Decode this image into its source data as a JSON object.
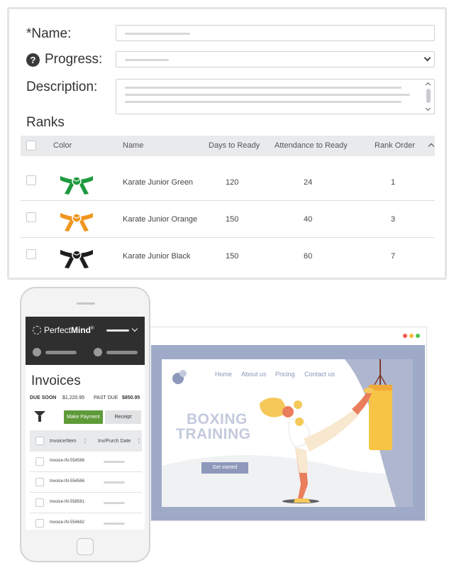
{
  "form": {
    "name_label": "*Name:",
    "progress_label": "Progress:",
    "help_glyph": "?",
    "description_label": "Description:"
  },
  "ranks": {
    "title": "Ranks",
    "columns": [
      "Color",
      "Name",
      "Days to Ready",
      "Attendance to Ready",
      "Rank Order"
    ],
    "rows": [
      {
        "belt_color": "#1f9a3e",
        "name": "Karate Junior Green",
        "days": "120",
        "attendance": "24",
        "order": "1"
      },
      {
        "belt_color": "#f0961e",
        "name": "Karate Junior Orange",
        "days": "150",
        "attendance": "40",
        "order": "3"
      },
      {
        "belt_color": "#1e1e1e",
        "name": "Karate Junior Black",
        "days": "150",
        "attendance": "60",
        "order": "7"
      }
    ]
  },
  "phone": {
    "brand_light": "Perfect",
    "brand_bold": "Mind",
    "brand_mark": "®",
    "title": "Invoices",
    "due_soon_label": "DUE SOON",
    "due_soon_value": "$1,220.95",
    "past_due_label": "PAST DUE",
    "past_due_value": "$850.95",
    "make_payment": "Make Payment",
    "receipt": "Receipt",
    "col_invoice": "Invoice/Item",
    "col_date": "Inv/Purch Date",
    "invoices": [
      "Invoice-IN-554586",
      "Invoice-IN-554566",
      "Invoice-IN-558581",
      "Invoice-IN-554682"
    ]
  },
  "website": {
    "nav": [
      "Home",
      "About us",
      "Pricing",
      "Contact us"
    ],
    "hero_line1": "BOXING",
    "hero_line2": "TRAINING",
    "cta": "Get started",
    "window_dots": [
      "#f25a4b",
      "#f5b73c",
      "#4fc553"
    ]
  },
  "colors": {
    "accent_green": "#5e9a38",
    "hero_frame": "#9eaac7",
    "bag_yellow": "#f7c445"
  }
}
